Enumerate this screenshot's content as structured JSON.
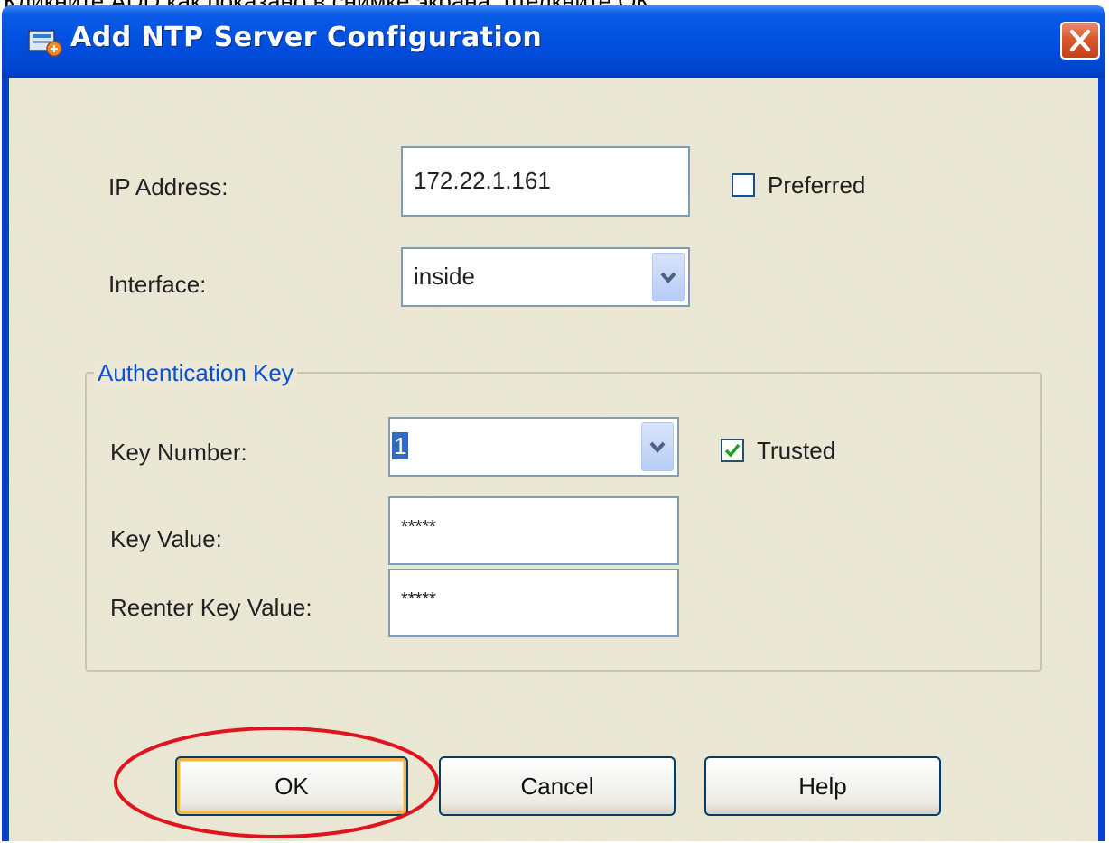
{
  "top_caption": "Кликните ADD как показано в снимке экрана. Щелкните ОК",
  "window": {
    "title": "Add NTP Server Configuration",
    "icon": "asdm-app-icon"
  },
  "form": {
    "ip_address_label": "IP Address:",
    "ip_address_value": "172.22.1.161",
    "preferred_label": "Preferred",
    "preferred_checked": false,
    "interface_label": "Interface:",
    "interface_value": "inside"
  },
  "auth_group": {
    "legend": "Authentication Key",
    "key_number_label": "Key Number:",
    "key_number_value": "1",
    "trusted_label": "Trusted",
    "trusted_checked": true,
    "key_value_label": "Key Value:",
    "key_value_value": "*****",
    "reenter_label": "Reenter Key Value:",
    "reenter_value": "*****"
  },
  "buttons": {
    "ok": "OK",
    "cancel": "Cancel",
    "help": "Help"
  },
  "colors": {
    "titlebar": "#0050e0",
    "client_bg": "#ebe8d6",
    "legend_text": "#0d4fd2",
    "highlight_ellipse": "#e0141e",
    "checkmark": "#21a121"
  }
}
